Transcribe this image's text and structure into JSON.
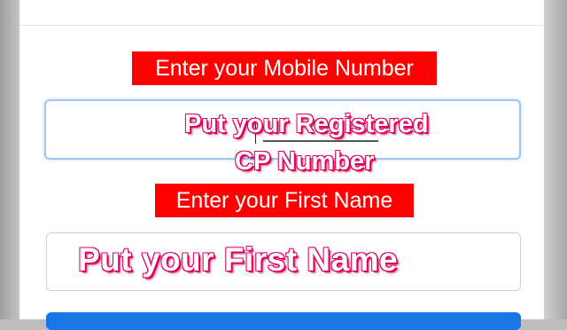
{
  "form": {
    "mobile_label": "Enter your Mobile Number",
    "mobile_hint_line1": "Put your Registered",
    "mobile_hint_line2": "CP Number",
    "first_name_label": "Enter your First Name",
    "first_name_hint": "Put your First Name"
  },
  "colors": {
    "label_background": "#ff0000",
    "overlay_text_shadow": "#e0005a",
    "focus_border": "#9ec6f3",
    "button": "#1976e6"
  }
}
